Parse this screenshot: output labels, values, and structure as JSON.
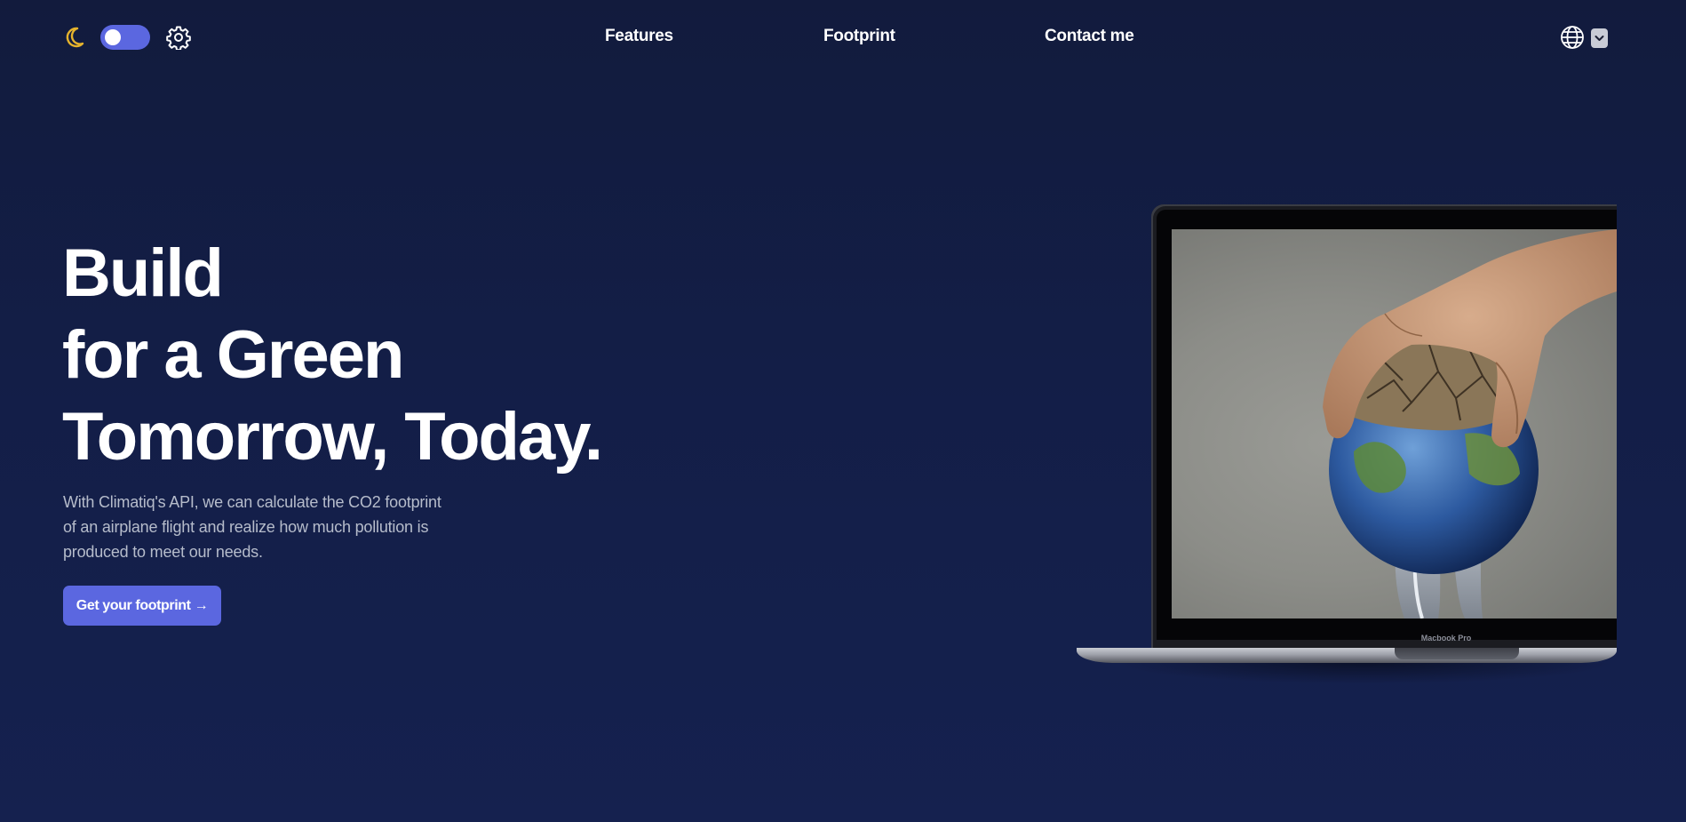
{
  "header": {
    "theme_toggle": {
      "state": "off"
    },
    "nav": [
      {
        "label": "Features"
      },
      {
        "label": "Footprint"
      },
      {
        "label": "Contact me"
      }
    ]
  },
  "hero": {
    "title_lines": [
      "Build",
      "for a Green",
      "Tomorrow, Today."
    ],
    "description": "With Climatiq's API, we can calculate the CO2 footprint of an airplane flight and realize how much pollution is produced to meet our needs.",
    "cta_label": "Get your footprint →"
  },
  "laptop": {
    "model_label": "Macbook Pro"
  },
  "colors": {
    "background": "#131e47",
    "accent": "#5b67e0",
    "moon": "#e5b32d",
    "text": "#ffffff",
    "muted_text": "#b6bccb"
  },
  "icons": [
    "moon-icon",
    "gear-icon",
    "globe-icon",
    "chevron-down-icon"
  ]
}
